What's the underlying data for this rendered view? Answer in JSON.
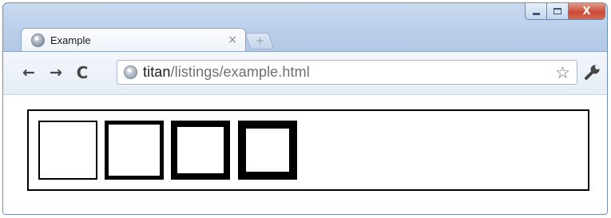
{
  "tab": {
    "title": "Example",
    "close_glyph": "×",
    "new_tab_glyph": "+"
  },
  "window_controls": {
    "close_glyph": "X"
  },
  "toolbar": {
    "back_glyph": "←",
    "forward_glyph": "→",
    "reload_glyph": "C",
    "bookmark_glyph": "☆"
  },
  "address": {
    "host": "titan",
    "path": "/listings/example.html"
  },
  "page": {
    "boxes": [
      {
        "label": ""
      },
      {
        "label": ""
      },
      {
        "label": ""
      },
      {
        "label": ""
      }
    ]
  },
  "icons": {
    "favicon": "globe-icon",
    "omnibox": "globe-icon",
    "bookmark": "star-icon",
    "menu": "wrench-icon"
  },
  "colors": {
    "frame": "#b8cde8",
    "close_button": "#c94a35",
    "page_background": "#ffffff",
    "border": "#000000"
  }
}
